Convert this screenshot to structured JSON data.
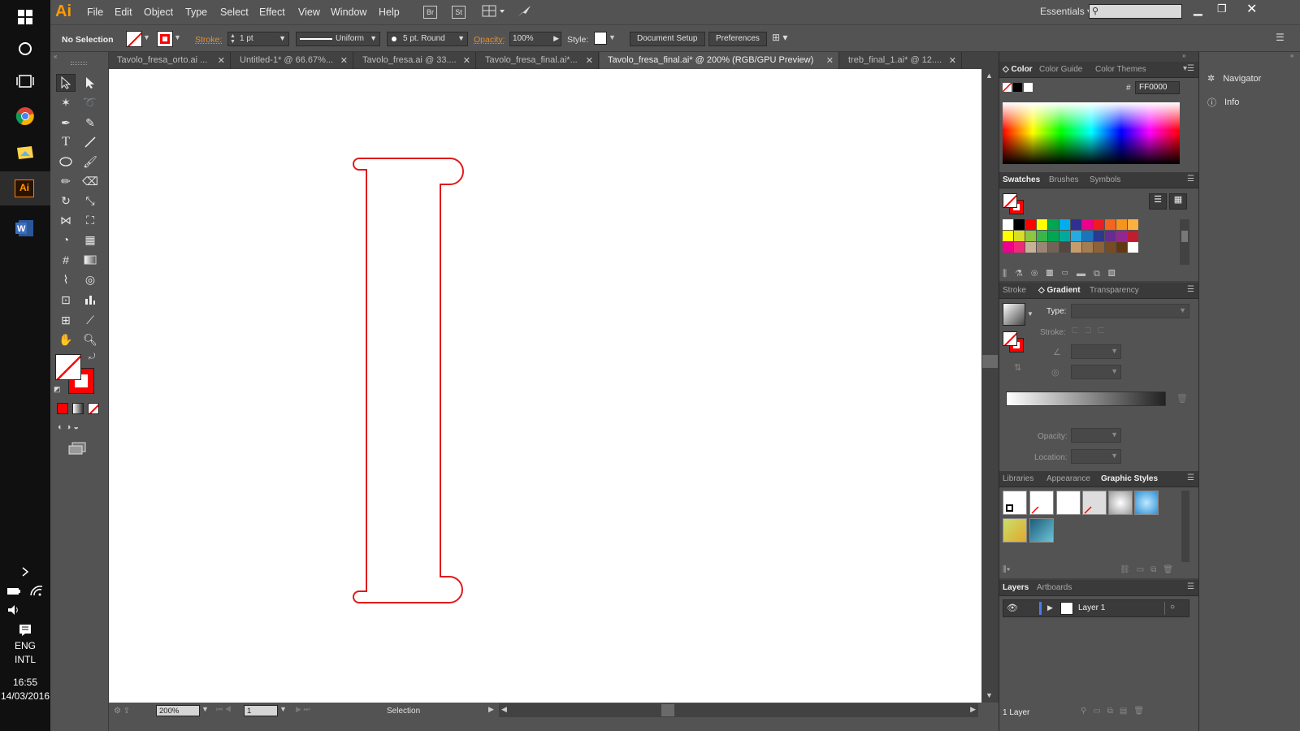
{
  "taskbar": {
    "lang_line1": "ENG",
    "lang_line2": "INTL",
    "time": "16:55",
    "date": "14/03/2016"
  },
  "app": {
    "logo": "Ai",
    "menu": [
      "File",
      "Edit",
      "Object",
      "Type",
      "Select",
      "Effect",
      "View",
      "Window",
      "Help"
    ],
    "bridge_label": "Br",
    "stock_label": "St",
    "workspace": "Essentials",
    "search_placeholder": ""
  },
  "control": {
    "selection": "No Selection",
    "stroke_label": "Stroke:",
    "stroke_weight": "1 pt",
    "profile": "Uniform",
    "brush": "5 pt. Round",
    "opacity_label": "Opacity:",
    "opacity": "100%",
    "style_label": "Style:",
    "doc_setup": "Document Setup",
    "preferences": "Preferences"
  },
  "tabs": [
    {
      "label": "Tavolo_fresa_orto.ai ...",
      "active": false
    },
    {
      "label": "Untitled-1* @ 66.67%...",
      "active": false
    },
    {
      "label": "Tavolo_fresa.ai @ 33....",
      "active": false
    },
    {
      "label": "Tavolo_fresa_final.ai*...",
      "active": false
    },
    {
      "label": "Tavolo_fresa_final.ai* @ 200% (RGB/GPU Preview)",
      "active": true
    },
    {
      "label": "treb_final_1.ai* @ 12....",
      "active": false
    }
  ],
  "status": {
    "zoom": "200%",
    "artboard": "1",
    "tool": "Selection"
  },
  "color_panel": {
    "tabs": [
      "Color",
      "Color Guide",
      "Color Themes"
    ],
    "hash": "#",
    "hex": "FF0000"
  },
  "swatches_panel": {
    "tabs": [
      "Swatches",
      "Brushes",
      "Symbols"
    ],
    "colors": [
      [
        "#ffffff",
        "#000000",
        "#ff0000",
        "#ffff00",
        "#00a651",
        "#00aeef",
        "#2e3192",
        "#ec008c",
        "#ed1c24",
        "#f26522",
        "#f7941d",
        "#fbb040"
      ],
      [
        "#ffff00",
        "#d7df23",
        "#8dc63f",
        "#39b54a",
        "#00a651",
        "#00a99d",
        "#27aae1",
        "#1c75bc",
        "#2b3990",
        "#662d91",
        "#92278f",
        "#be1e2d"
      ],
      [
        "#ec008c",
        "#ee2a7b",
        "#c7b299",
        "#998675",
        "#736357",
        "#534741",
        "#c69c6d",
        "#a67c52",
        "#8c6239",
        "#754c24",
        "#603913",
        "#ffffff"
      ]
    ]
  },
  "gradient_panel": {
    "tabs": [
      "Stroke",
      "Gradient",
      "Transparency"
    ],
    "type_label": "Type:",
    "stroke_label": "Stroke:",
    "opacity_label": "Opacity:",
    "location_label": "Location:"
  },
  "graphic_styles_panel": {
    "tabs": [
      "Libraries",
      "Appearance",
      "Graphic Styles"
    ]
  },
  "layers_panel": {
    "tabs": [
      "Layers",
      "Artboards"
    ],
    "layer_name": "Layer 1",
    "footer": "1 Layer"
  },
  "dock": {
    "navigator": "Navigator",
    "info": "Info"
  },
  "colors": {
    "accent": "#ff0000",
    "ui_dark": "#535353",
    "ui_darker": "#424242",
    "orange_label": "#e8902c"
  }
}
